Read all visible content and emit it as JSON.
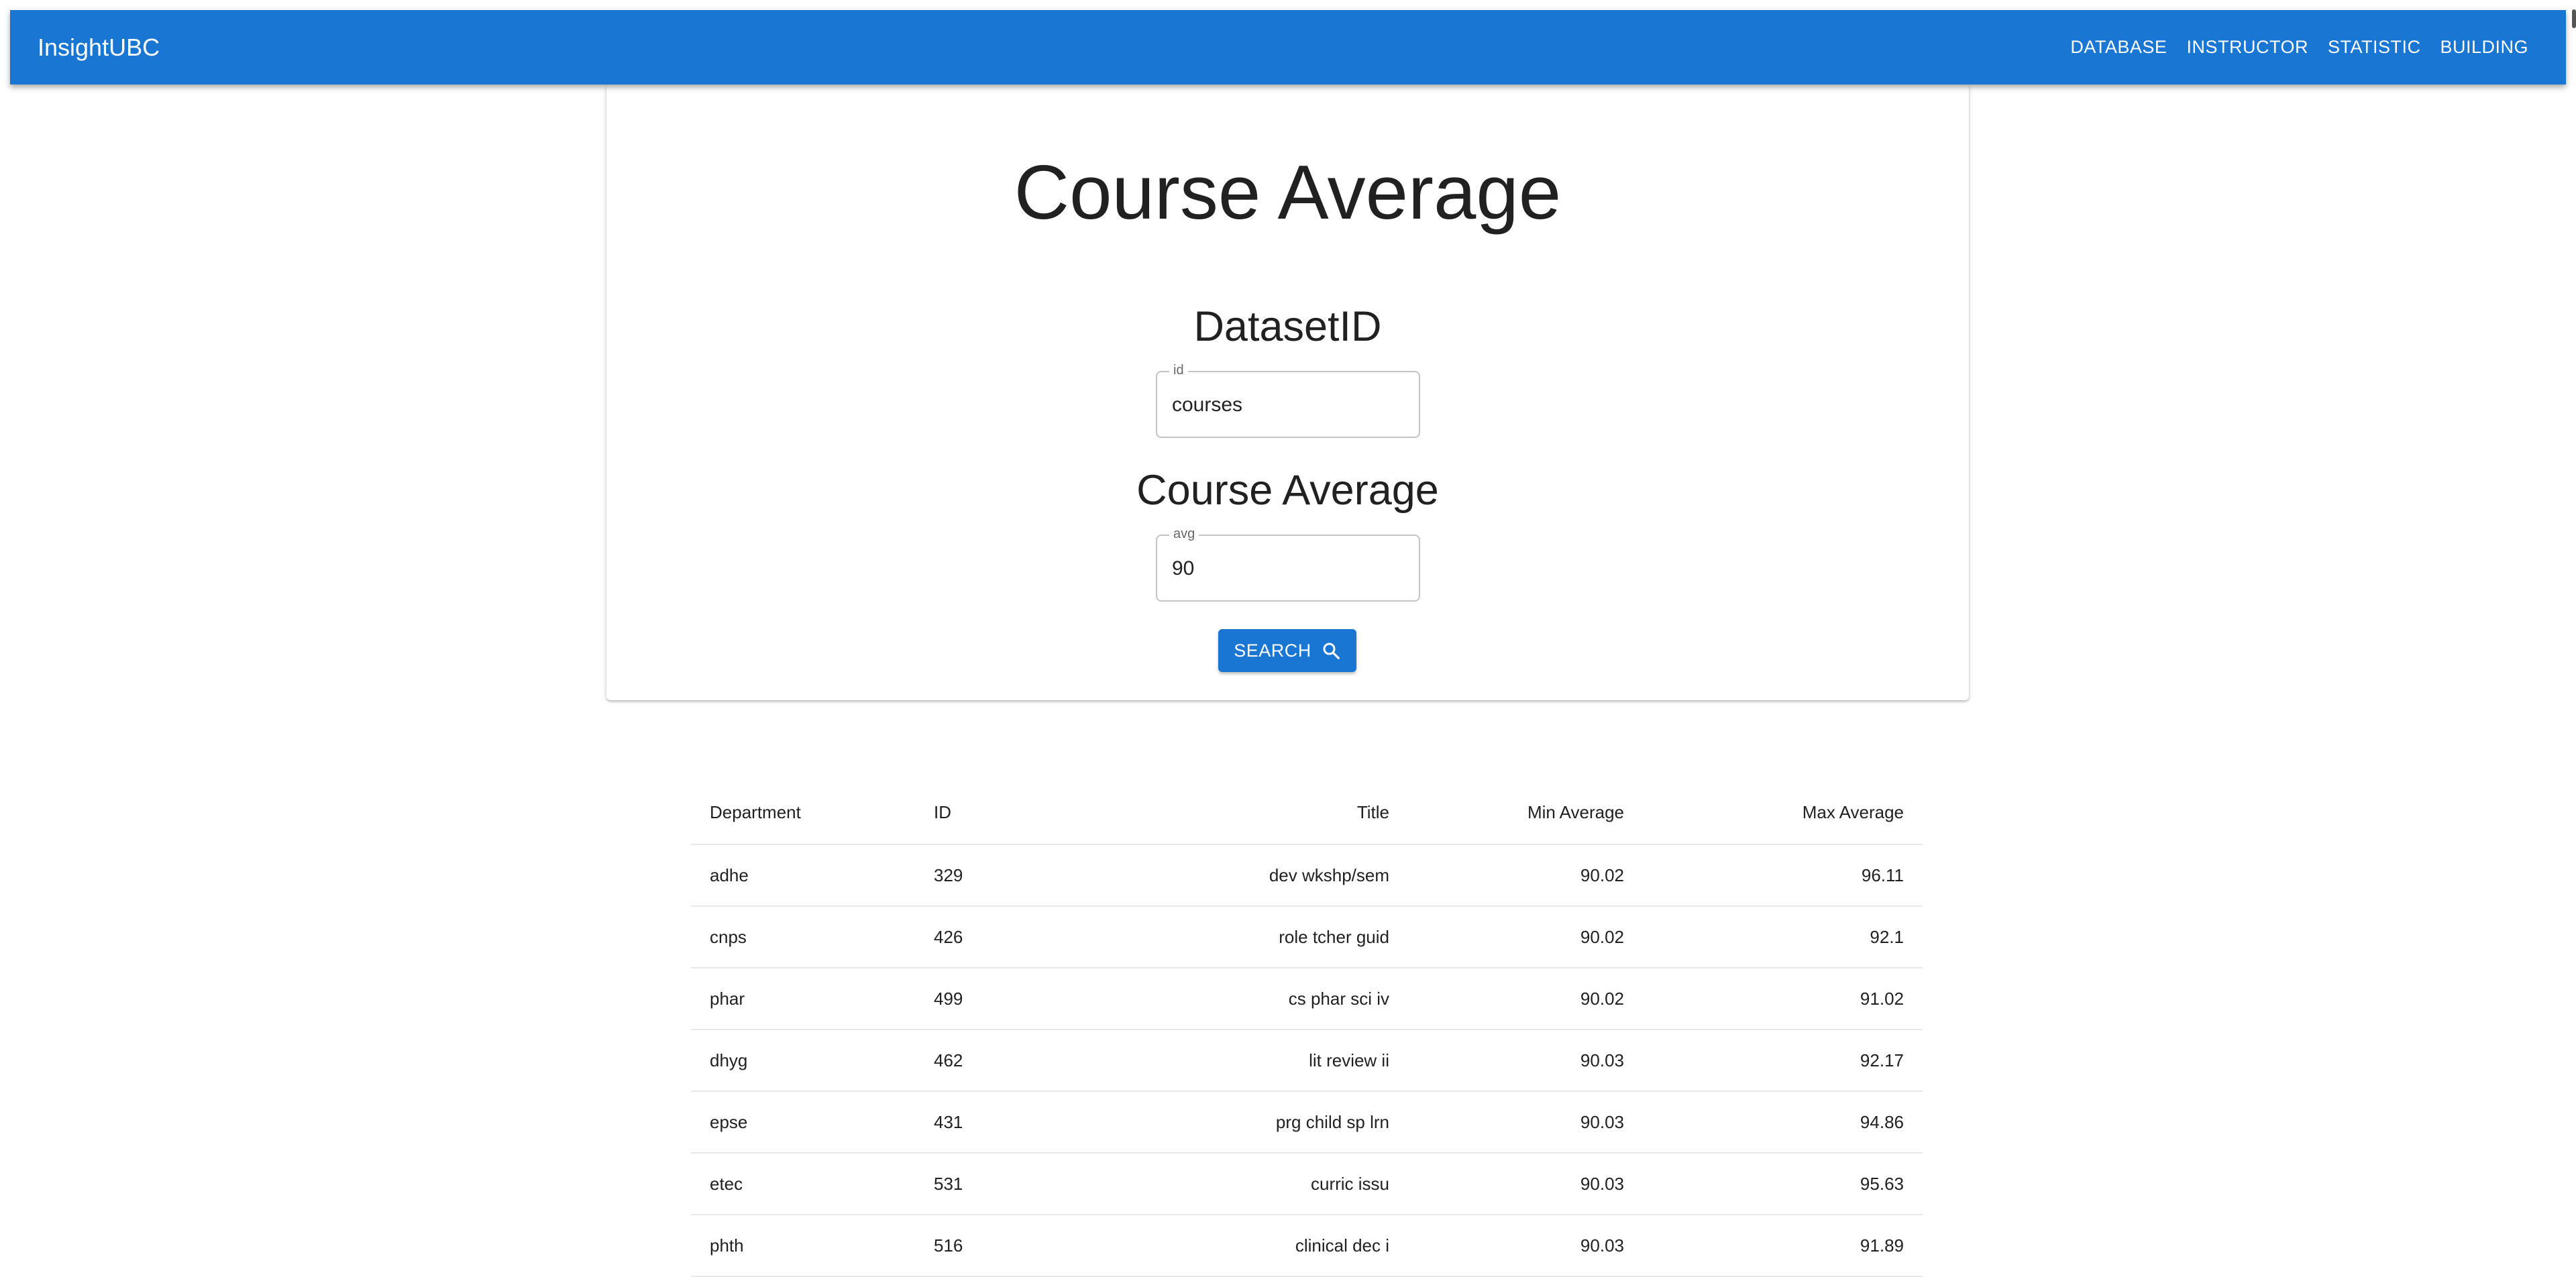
{
  "appbar": {
    "brand": "InsightUBC",
    "nav": [
      "DATABASE",
      "INSTRUCTOR",
      "STATISTIC",
      "BUILDING"
    ]
  },
  "card": {
    "title": "Course Average",
    "dataset_section": {
      "heading": "DatasetID",
      "field_label": "id",
      "value": "courses"
    },
    "avg_section": {
      "heading": "Course Average",
      "field_label": "avg",
      "value": "90"
    },
    "search_button": {
      "label": "SEARCH",
      "icon": "search-icon"
    }
  },
  "table": {
    "headers": [
      "Department",
      "ID",
      "Title",
      "Min Average",
      "Max Average"
    ],
    "rows": [
      [
        "adhe",
        "329",
        "dev wkshp/sem",
        "90.02",
        "96.11"
      ],
      [
        "cnps",
        "426",
        "role tcher guid",
        "90.02",
        "92.1"
      ],
      [
        "phar",
        "499",
        "cs phar sci iv",
        "90.02",
        "91.02"
      ],
      [
        "dhyg",
        "462",
        "lit review ii",
        "90.03",
        "92.17"
      ],
      [
        "epse",
        "431",
        "prg child sp lrn",
        "90.03",
        "94.86"
      ],
      [
        "etec",
        "531",
        "curric issu",
        "90.03",
        "95.63"
      ],
      [
        "phth",
        "516",
        "clinical dec i",
        "90.03",
        "91.89"
      ]
    ]
  },
  "colors": {
    "primary": "#1976d2",
    "text": "#212121",
    "border": "#c4c4c4"
  }
}
